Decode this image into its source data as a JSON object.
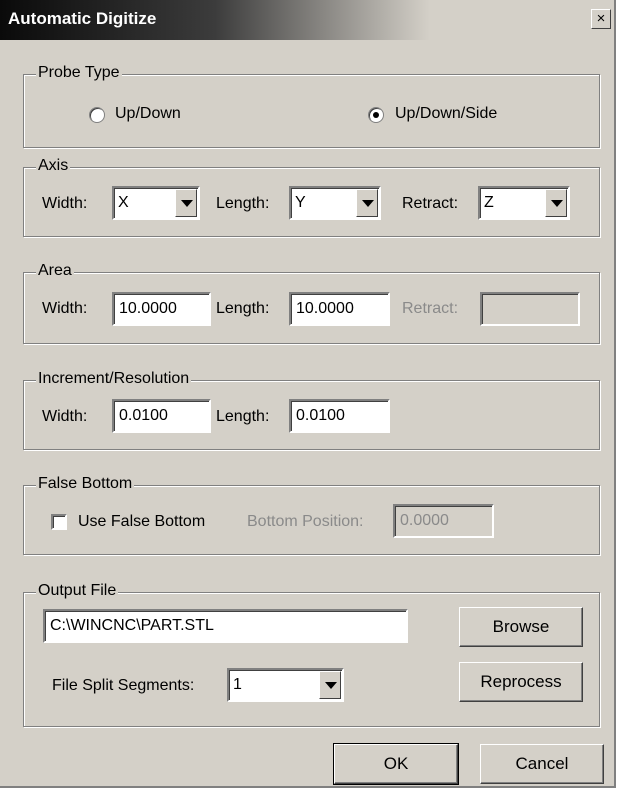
{
  "window": {
    "title": "Automatic Digitize",
    "close_glyph": "×"
  },
  "probe_type": {
    "legend": "Probe Type",
    "options": [
      {
        "label": "Up/Down",
        "selected": false
      },
      {
        "label": "Up/Down/Side",
        "selected": true
      }
    ]
  },
  "axis": {
    "legend": "Axis",
    "width_label": "Width:",
    "width_value": "X",
    "length_label": "Length:",
    "length_value": "Y",
    "retract_label": "Retract:",
    "retract_value": "Z"
  },
  "area": {
    "legend": "Area",
    "width_label": "Width:",
    "width_value": "10.0000",
    "length_label": "Length:",
    "length_value": "10.0000",
    "retract_label": "Retract:",
    "retract_value": ""
  },
  "increment": {
    "legend": "Increment/Resolution",
    "width_label": "Width:",
    "width_value": "0.0100",
    "length_label": "Length:",
    "length_value": "0.0100"
  },
  "false_bottom": {
    "legend": "False Bottom",
    "checkbox_label": "Use False Bottom",
    "checked": false,
    "position_label": "Bottom Position:",
    "position_value": "0.0000"
  },
  "output_file": {
    "legend": "Output File",
    "path": "C:\\WINCNC\\PART.STL",
    "browse_label": "Browse",
    "split_label": "File Split Segments:",
    "split_value": "1",
    "reprocess_label": "Reprocess"
  },
  "buttons": {
    "ok_label": "OK",
    "cancel_label": "Cancel"
  }
}
